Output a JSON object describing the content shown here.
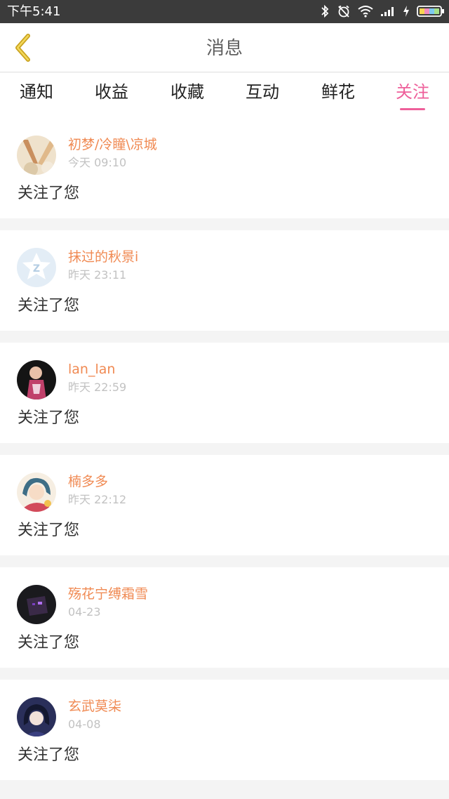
{
  "status_bar": {
    "time": "下午5:41"
  },
  "header": {
    "title": "消息",
    "back_icon": "chevron-left-icon",
    "accent_color": "#c9a21f"
  },
  "tabs": [
    {
      "label": "通知",
      "active": false
    },
    {
      "label": "收益",
      "active": false
    },
    {
      "label": "收藏",
      "active": false
    },
    {
      "label": "互动",
      "active": false
    },
    {
      "label": "鲜花",
      "active": false
    },
    {
      "label": "关注",
      "active": true
    }
  ],
  "colors": {
    "active_tab": "#ee5f9a",
    "username": "#f08a53",
    "timestamp": "#c2c2c2"
  },
  "notifications": [
    {
      "username": "初梦/冷瞳\\凉城",
      "time": "今天 09:10",
      "message": "关注了您"
    },
    {
      "username": "抹过的秋景i",
      "time": "昨天 23:11",
      "message": "关注了您"
    },
    {
      "username": "lan_lan",
      "time": "昨天 22:59",
      "message": "关注了您"
    },
    {
      "username": "楠多多",
      "time": "昨天 22:12",
      "message": "关注了您"
    },
    {
      "username": "殇花宁缚霜雪",
      "time": "04-23",
      "message": "关注了您"
    },
    {
      "username": "玄武莫柒",
      "time": "04-08",
      "message": "关注了您"
    }
  ]
}
